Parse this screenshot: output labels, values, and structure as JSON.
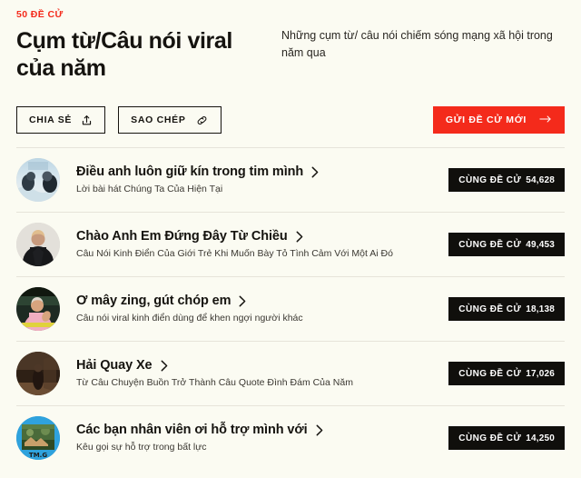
{
  "header": {
    "eyebrow": "50 ĐỀ CỬ",
    "title": "Cụm từ/Câu nói viral của năm",
    "subtitle": "Những cụm từ/ câu nói chiếm sóng mạng xã hội trong năm qua"
  },
  "actions": {
    "share_label": "CHIA SẺ",
    "share_icon": "share-upload-icon",
    "copy_label": "SAO CHÉP",
    "copy_icon": "link-icon",
    "submit_label": "GỬI ĐỀ CỬ MỚI",
    "submit_icon": "arrow-right-icon",
    "submit_color": "#f42a1b"
  },
  "badge_prefix": "CÙNG ĐỀ CỬ",
  "colors": {
    "background": "#fbfbf2",
    "accent": "#f42a1b",
    "badge_bg": "#100f0c",
    "text": "#15130f",
    "divider": "#e6e4da"
  },
  "items": [
    {
      "title": "Điều anh luôn giữ kín trong tim mình",
      "subtitle": "Lời bài hát Chúng Ta Của Hiện Tại",
      "votes": "54,628",
      "avatar_name": "avatar-dieu-anh-luon-giu-kin"
    },
    {
      "title": "Chào Anh Em Đứng Đây Từ Chiều",
      "subtitle": "Câu Nói Kinh Điển Của Giới Trẻ Khi Muốn Bày Tỏ Tình Cảm Với Một Ai Đó",
      "votes": "49,453",
      "avatar_name": "avatar-chao-anh-em-dung-day-tu-chieu"
    },
    {
      "title": "Ơ mây zing, gút chóp em",
      "subtitle": "Câu nói viral kinh điển dùng để khen ngợi người khác",
      "votes": "18,138",
      "avatar_name": "avatar-o-may-zing-gut-chop-em"
    },
    {
      "title": "Hải Quay Xe",
      "subtitle": "Từ Câu Chuyện Buồn Trở Thành Câu Quote Đình Đám Của Năm",
      "votes": "17,026",
      "avatar_name": "avatar-hai-quay-xe"
    },
    {
      "title": "Các bạn nhân viên ơi hỗ trợ mình với",
      "subtitle": "Kêu gọi sự hỗ trợ trong bất lực",
      "votes": "14,250",
      "avatar_name": "avatar-cac-ban-nhan-vien-oi-ho-tro-minh-voi"
    }
  ]
}
